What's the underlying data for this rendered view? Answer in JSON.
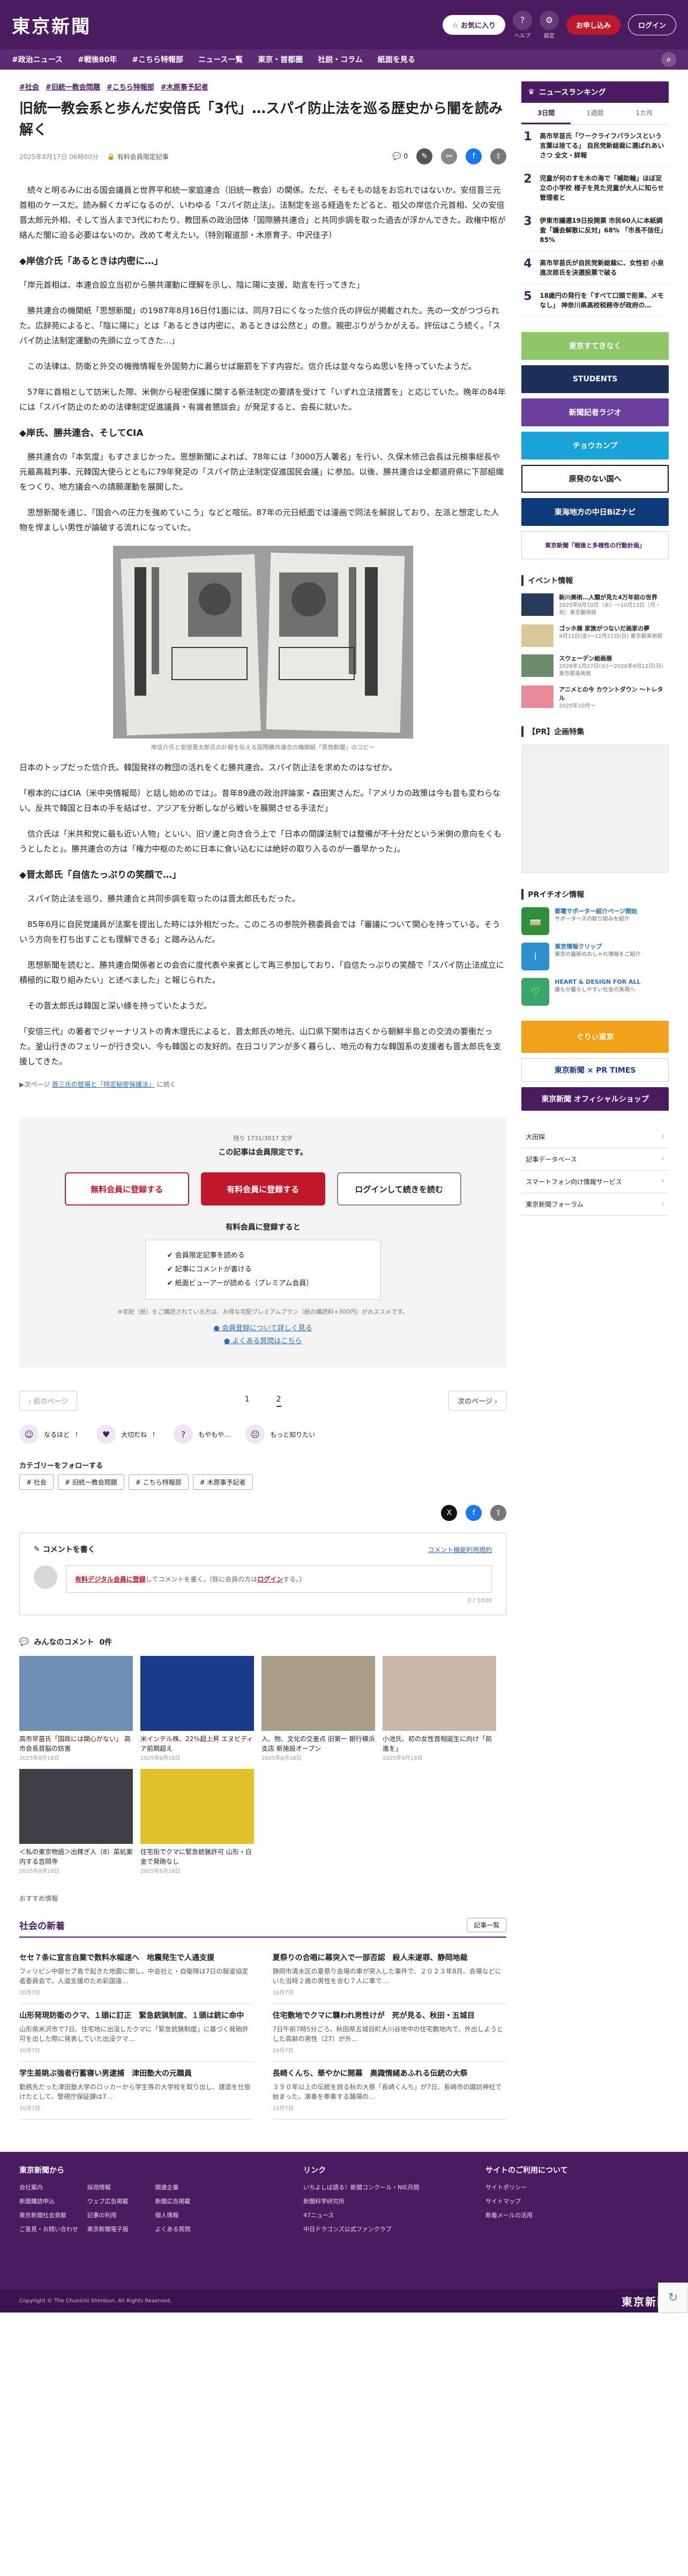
{
  "header": {
    "logo": "東京新聞",
    "favorites_label": "お気に入り",
    "icon1_label": "ヘルプ",
    "icon2_label": "設定",
    "subscribe_label": "お申し込み",
    "login_label": "ログイン"
  },
  "nav": [
    "#政治ニュース",
    "#戦後80年",
    "#こちら特報部",
    "ニュース一覧",
    "東京・首都圏",
    "社説・コラム",
    "紙面を見る"
  ],
  "article": {
    "tags": [
      "#社会",
      "#旧統一教会問題",
      "#こちら特報部",
      "#木原事予記者"
    ],
    "title": "旧統一教会系と歩んだ安倍氏「3代」…スパイ防止法を巡る歴史から闇を読み解く",
    "date": "2025年8月17日 06時00分",
    "paid_label": "有料会員限定記事",
    "share_count": "0",
    "p1": "　続々と明るみに出る国会議員と世界平和統一家庭連合（旧統一教会）の関係。ただ、そもそもの話をお忘れではないか。安倍晋三元首相のケースだ。読み解くカギになるのが、いわゆる「スパイ防止法」。法制定を巡る経過をたどると、祖父の岸信介元首相、父の安倍晋太郎元外相、そして当人まで3代にわたり、教団系の政治団体「国際勝共連合」と共同歩調を取った過去が浮かんできた。政権中枢が絡んだ闇に迫る必要はないのか。改めて考えたい。（特別報道部・木原育子、中沢佳子）",
    "h1": "◆岸信介氏「あるときは内密に…」",
    "p2": "「岸元首相は、本連合設立当初から勝共運動に理解を示し、陰に陽に支援、助言を行ってきた」",
    "p3": "　勝共連合の機関紙「思想新聞」の1987年8月16日付1面には、同月7日にくなった信介氏の評伝が掲載された。先の一文がつづられた。広辞苑によると、「陰に陽に」とは「あるときは内密に、あるときは公然と」の意。親密ぶりがうかがえる。評伝はこう続く。「スパイ防止法制定運動の先頭に立ってきた…」",
    "p4": "　この法律は、防衛と外交の機微情報を外国勢力に漏らせば厳罰を下す内容だ。信介氏は並々ならぬ思いを持っていたようだ。",
    "p5": "　57年に首相として訪米した際、米側から秘密保護に関する新法制定の要請を受けて「いずれ立法措置を」と応じていた。晩年の84年には「スパイ防止のための法律制定促進議員・有識者懇談会」が発足すると、会長に就いた。",
    "h2": "◆岸氏、勝共連合、そしてCIA",
    "p6": "　勝共連合の「本気度」もすさまじかった。思想新聞によれば、78年には「3000万人署名」を行い、久保木修己会長は元検事総長や元最高裁判事、元韓国大使らとともに79年発足の「スパイ防止法制定促進国民会議」に参加。以後、勝共連合は全都道府県に下部組織をつくり、地方議会への請願運動を展開した。",
    "p7": "　思想新聞を通じ、「国会への圧力を強めていこう」などと喧伝。87年の元日紙面では漫画で同法を解説しており、左派と想定した人物を悍ましい男性が論破する流れになっていた。",
    "caption": "岸信介氏と安倍晋太郎氏の計報を伝える国際勝共連合の機関紙「思想新聞」のコピー",
    "p8": "日本のトップだった信介氏。韓国発祥の教団の活れをくむ勝共連合。スパイ防止法を求めたのはなぜか。",
    "p9": "「根本的にはCIA（米中央情報局）と話し始めのでは」。昔年89歳の政治評論家・森田実さんだ。「アメリカの政策は今も昔も変わらない。反共で韓国と日本の手を結ばせ、アジアを分断しながら戦いを展開させる手法だ」",
    "p10": "　信介氏は「米共和党に最も近い人物」といい、旧ソ連と向き合う上で「日本の間諜法制では整備が不十分だという米側の意向をくもうとしたと」。勝共連合の方は「権力中枢のために日本に食い込むには絶好の取り入るのが一番早かった」。",
    "h3": "◆晋太郎氏「自信たっぷりの笑顔で…」",
    "p11": "　スパイ防止法を巡り、勝共連合と共同歩調を取ったのは晋太郎氏もだった。",
    "p12": "　85年6月に自民党議員が法案を提出した時には外相だった。このころの参院外務委員会では「審議について関心を持っている。そういう方向を打ち出すことも理解できる」と踏み込んだ。",
    "p13": "　思想新聞を読むと、勝共連合関係者との会合に度代表や来賓として再三参加しており、「自信たっぷりの笑顔で「スパイ防止法成立に積極的に取り組みたい」と述べました」と報じられた。",
    "p14": "　その晋太郎氏は韓国と深い縁を持っていたようだ。",
    "p15": "「安倍三代」の著者でジャーナリストの青木理氏によると、晋太郎氏の地元、山口県下関市は古くから朝鮮半島との交流の要衝だった。釜山行きのフェリーが行き交い、今も韓国との友好的。在日コリアンが多く暮らし、地元の有力な韓国系の支援者も晋太郎氏を支援してきた。",
    "next_prefix": "▶次ページ",
    "next_link": "晋三氏の登場と「特定秘密保護法」",
    "next_suffix": "に続く"
  },
  "paywall": {
    "rest": "残り 1731/3017 文字",
    "lead": "この記事は会員限定です。",
    "btn_free": "無料会員に登録する",
    "btn_paid": "有料会員に登録する",
    "btn_login": "ログインして続きを読む",
    "benefits_title": "有料会員に登録すると",
    "benefits": [
      "会員限定記事を読める",
      "記事にコメントが書ける",
      "紙面ビューアーが読める（プレミアム会員）"
    ],
    "note": "※宅配（紙）をご購読されている方は、お得な宅配プレミアムプラン（紙の購読料+300円）がおススメです。",
    "link1": "会員登録について詳しく見る",
    "link2": "よくある質問はこちら"
  },
  "pager": {
    "prev": "前のページ",
    "next": "次のページ",
    "pages": [
      "1",
      "2"
    ],
    "current": "2"
  },
  "reactions": [
    {
      "icon": "☺",
      "label": "なるほど",
      "count": "！"
    },
    {
      "icon": "♥",
      "label": "大切だね",
      "count": "！"
    },
    {
      "icon": "?",
      "label": "もやもや…",
      "count": ""
    },
    {
      "icon": "☹",
      "label": "もっと知りたい",
      "count": ""
    }
  ],
  "follow": {
    "title": "カテゴリーをフォローする",
    "tags": [
      "# 社会",
      "# 旧統一教会問題",
      "# こちら特報部",
      "# 木原事予記者"
    ]
  },
  "comments": {
    "title": "コメントを書く",
    "rule": "コメント機能利用規約",
    "prompt_a": "有料デジタル会員に登録",
    "prompt_b": "してコメントを書く。(既に会員の方は",
    "prompt_login": "ログイン",
    "prompt_c": "する。)",
    "count": "0 / 1000"
  },
  "minna": {
    "title": "みんなのコメント",
    "count": "0件"
  },
  "thumbs": [
    {
      "t": "高市早苗氏「国政には関心がない」 高市会長首脳の妨害",
      "d": "2025年8月18日"
    },
    {
      "t": "米インテル株、22％超上昇 エヌビディア前期超え",
      "d": "2025年8月18日"
    },
    {
      "t": "入、物、文化の交差点 旧第一 銀行横浜支店 新施設オープン",
      "d": "2025年8月18日"
    },
    {
      "t": "小池氏、初の女性首相誕生に向け「前進を」",
      "d": "2025年8月18日"
    },
    {
      "t": "＜私の東京物語＞出稼ぎ人（8）菜処案内する吉岡寺",
      "d": "2025年8月18日"
    },
    {
      "t": "住宅街でクマに緊急銃猟許可 山形・白金で発砲なし",
      "d": "2025年8月18日"
    }
  ],
  "osusume": "おすすめ情報",
  "social": {
    "title": "社会の新着",
    "more": "記事一覧",
    "items": [
      {
        "h": "セセ７条に宣言自棄で数料水幅速へ　地震発生で人通支援",
        "p": "フィリピン中部セブ島で起きた地震に関し、中会社と・自衛隊は7日の報道協定者委員会で、人道支援のため彩国遠…",
        "d": "10月7日"
      },
      {
        "h": "夏祭りの合唱に幕突入で一部否認　殺人未遂罪、静岡地裁",
        "p": "静岡市清水区の夏祭り会場の車が突入した事件で、２０２３年8月、会場などにいた当時２歳の男性を含む７人に車で…",
        "d": "10月7日"
      },
      {
        "h": "山形発現防衛のクマ、１頭に訂正　緊急銃猟制度、１頭は銃に命中",
        "p": "山形県米沢市で7日、住宅地に出没したクマに「緊急銃猟制度」に基づく発砲許可を出した際に発表していた出没クマ…",
        "d": "10月7日"
      },
      {
        "h": "住宅敷地でクマに襲われ男性けが　死が見る、秋田・五城目",
        "p": "7日午前7時5分ごろ、秋田県五城目町大川谷地中の住宅敷地内で、外出しようとした高齢の男性（27）が外…",
        "d": "10月7日"
      },
      {
        "h": "学生差眺ぶ強者行蓄寝い男逮捕　津田塾大の元職員",
        "p": "勤務先だった津田塾大学のロッカーから学生等の大学校を取り出し、建造を仕掛けたとして、警視庁保証課は7…",
        "d": "10月7日"
      },
      {
        "h": "長崎くんち、華やかに開幕　奥諏情緒あふれる伝統の大祭",
        "p": "３９０年以上の伝統を誇る秋の大祭「長崎くんち」が7日、長崎市の諏訪神社で始まった。演奏を奉奏する踊場の…",
        "d": "10月7日"
      }
    ]
  },
  "sidebar": {
    "rank_title": "ニュースランキング",
    "tabs": [
      "3日間",
      "1週間",
      "1カ月"
    ],
    "ranking": [
      "高市早苗氏「ワークライフバランスという言葉は捨てる」 自民党新総裁に選ばれあいさつ 全文・詳報",
      "児童が何のすを木の海で「補助輪」ほぼ足立の小学校 様子を見た児童が大人に知らせ管理者と",
      "伊東市議選19日投開票 市民60人に本紙調査「議会解散に反対」68% 「市長不信任」85%",
      "高市早苗氏が自民党新総裁に、女性初 小泉進次郎氏を決選投票で破る",
      "18歳円の発行を「すべて口頭で拒果、メモなし」 神奈川県高校税務寺が政府の…"
    ],
    "ads": [
      "東京すてきなく",
      "STUDENTS",
      "新聞記者ラジオ",
      "チョウカンプ",
      "原発のない国へ",
      "東海地方の中日BiZナビ",
      "東京新聞「戦後と多様性の行動計画」"
    ],
    "event_title": "イベント情報",
    "events": [
      {
        "t": "新川美術…人類が見た4万年前の世界",
        "d": "2025年9月10日（水）〜10月13日（月・祝）東京藝術館"
      },
      {
        "t": "ゴッホ展 家族がつないだ画家の夢",
        "d": "9月12日(金)〜12月21日(日) 東京都美術館"
      },
      {
        "t": "スウェーデン絵画展",
        "d": "2026年1月27日(火)〜2026年4月12日(日) 東京都美術館"
      },
      {
        "t": "アニメとの今 カウントダウン 〜トレタル",
        "d": "2025年10月〜"
      }
    ],
    "pr_title": "【PR】企画特集",
    "prinfo_title": "PRイチオシ情報",
    "prinfo": [
      {
        "t": "都電サポーター紹介ページ開始",
        "d": "サポーターズの取り組みを紹介"
      },
      {
        "t": "東京情報クリップ",
        "d": "東京の最新のおしゃれ情報をご紹介"
      },
      {
        "t": "HEART & DESIGN FOR ALL",
        "d": "誰もが暮らしやすい社会の実現へ"
      }
    ],
    "banners": [
      "ぐりぃ東京",
      "東京新聞 × PR TIMES",
      "東京新聞 オフィシャルショップ"
    ],
    "links": [
      "大田探",
      "記事データベース",
      "スマートフォン向け情報サービス",
      "東京新聞フォーラム"
    ]
  },
  "footer": {
    "col1_title": "東京新聞から",
    "col1": [
      "会社案内",
      "採用情報",
      "関連企業",
      "新聞購読申込",
      "ウェブ広告掲載",
      "新聞広告掲載",
      "東京新聞社会貢献",
      "記事の利用",
      "個人情報",
      "ご意見・お問い合わせ",
      "東京新聞電子版",
      "よくある質問"
    ],
    "col2_title": "リンク",
    "col2": [
      "いちよしば語る！新聞コンクール・NIE月間",
      "新聞科学研究所",
      "47ニュース",
      "中日ドラゴンズ公式ファンクラブ"
    ],
    "col3_title": "サイトのご利用について",
    "col3": [
      "サイトポリシー",
      "サイトマップ",
      "新着メールの活用"
    ],
    "copyright": "Copyright © The Chunichi Shimbun, All Rights Reserved.",
    "logo": "東京新聞"
  }
}
